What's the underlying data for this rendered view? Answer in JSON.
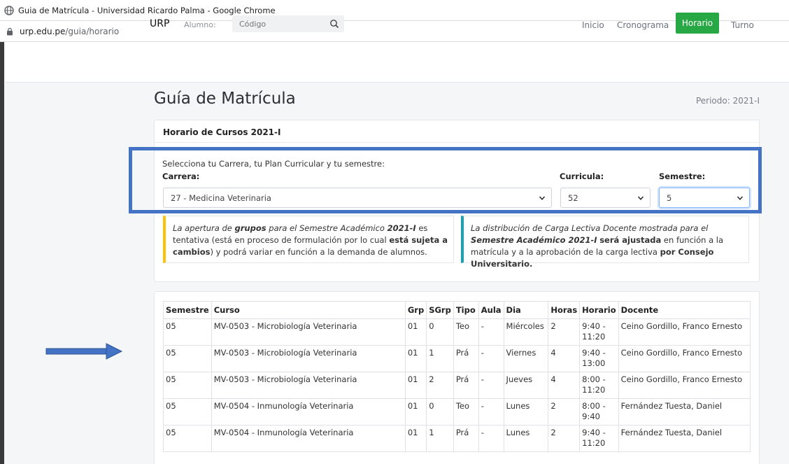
{
  "window": {
    "title": "Guia de Matrícula - Universidad Ricardo Palma - Google Chrome",
    "url_domain": "urp.edu.pe",
    "url_path": "/guia/horario"
  },
  "navbar": {
    "brand": "URP",
    "alumno_label": "Alumno:",
    "codigo_placeholder": "Código",
    "links": [
      "Inicio",
      "Cronograma",
      "Horario",
      "Turno"
    ],
    "active": "Horario",
    "active_color": "#28a745"
  },
  "page": {
    "title": "Guía de Matrícula",
    "periodo": "Periodo: 2021-I"
  },
  "schedule_card": {
    "header": "Horario de Cursos 2021-I",
    "intro": "Selecciona tu Carrera, tu Plan Curricular y tu semestre:",
    "carrera_label": "Carrera:",
    "carrera_value": "27 - Medicina Veterinaria",
    "curricula_label": "Curricula:",
    "curricula_value": "52",
    "semestre_label": "Semestre:",
    "semestre_value": "5",
    "highlight_color": "#4472c4"
  },
  "alerts": {
    "warning": {
      "t1": "La apertura de ",
      "t2": "grupos",
      "t3": " para el Semestre Académico ",
      "t4": "2021-I",
      "t5": " es tentativa (está en proceso de formulación por lo cual ",
      "t6": "está sujeta a cambios",
      "t7": ") y podrá variar en función a la demanda de alumnos."
    },
    "info": {
      "t1": "La distribución de Carga Lectiva Docente mostrada para el ",
      "t2": "Semestre Académico 2021-I",
      "t3": " ",
      "t4": "será ajustada",
      "t5": " en función a la matrícula y a la aprobación de la carga lectiva ",
      "t6": "por Consejo Universitario."
    }
  },
  "table": {
    "headers": [
      "Semestre",
      "Curso",
      "Grp",
      "SGrp",
      "Tipo",
      "Aula",
      "Dia",
      "Horas",
      "Horario",
      "Docente"
    ],
    "rows": [
      [
        "05",
        "MV-0503 - Microbiología Veterinaria",
        "01",
        "0",
        "Teo",
        "-",
        "Miércoles",
        "2",
        "9:40 - 11:20",
        "Ceino Gordillo, Franco Ernesto"
      ],
      [
        "05",
        "MV-0503 - Microbiología Veterinaria",
        "01",
        "1",
        "Prá",
        "-",
        "Viernes",
        "4",
        "9:40 - 13:00",
        "Ceino Gordillo, Franco Ernesto"
      ],
      [
        "05",
        "MV-0503 - Microbiología Veterinaria",
        "01",
        "2",
        "Prá",
        "-",
        "Jueves",
        "4",
        "8:00 - 11:20",
        "Ceino Gordillo, Franco Ernesto"
      ],
      [
        "05",
        "MV-0504 - Inmunología Veterinaria",
        "01",
        "0",
        "Teo",
        "-",
        "Lunes",
        "2",
        "8:00 - 9:40",
        "Fernández Tuesta, Daniel"
      ],
      [
        "05",
        "MV-0504 - Inmunología Veterinaria",
        "01",
        "1",
        "Prá",
        "-",
        "Lunes",
        "2",
        "9:40 - 11:20",
        "Fernández Tuesta, Daniel"
      ]
    ]
  },
  "annotation": {
    "arrow_color": "#4472c4"
  }
}
